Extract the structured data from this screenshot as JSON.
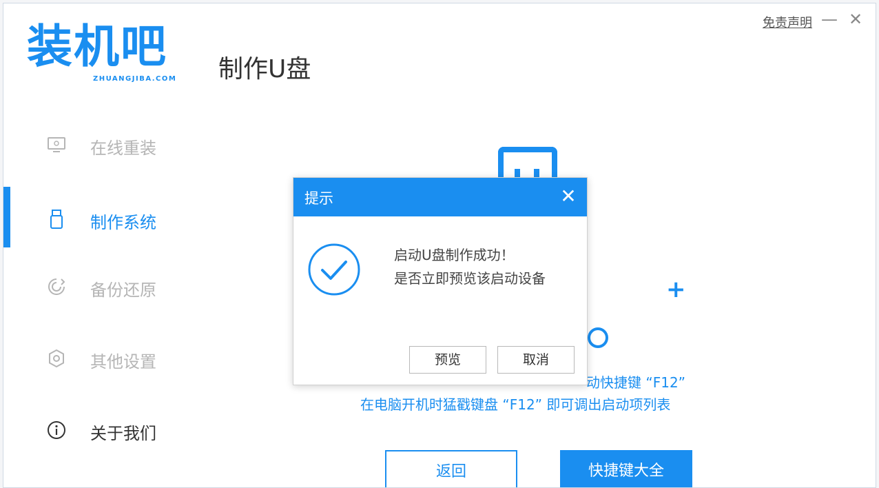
{
  "app": {
    "logo_main": "装机吧",
    "logo_sub": "ZHUANGJIBA.COM",
    "page_title": "制作U盘",
    "disclaimer": "免责声明",
    "minimize_glyph": "—",
    "close_glyph": "✕"
  },
  "sidebar": {
    "items": [
      {
        "label": "在线重装",
        "icon": "monitor-icon"
      },
      {
        "label": "制作系统",
        "icon": "usb-drive-icon",
        "active": true
      },
      {
        "label": "备份还原",
        "icon": "backup-icon"
      },
      {
        "label": "其他设置",
        "icon": "gear-icon"
      },
      {
        "label": "关于我们",
        "icon": "info-icon"
      }
    ]
  },
  "main": {
    "plus_glyph": "+",
    "hint_line1": "动快捷键 “F12”",
    "hint_line2": "在电脑开机时猛戳键盘 “F12” 即可调出启动项列表",
    "back_button": "返回",
    "hotkeys_button": "快捷键大全"
  },
  "dialog": {
    "title": "提示",
    "close_glyph": "✕",
    "message_line1": "启动U盘制作成功！",
    "message_line2": "是否立即预览该启动设备",
    "preview_button": "预览",
    "cancel_button": "取消"
  },
  "colors": {
    "accent": "#1a8ef0",
    "muted_text": "#b5b5b5",
    "dark_text": "#333333"
  }
}
